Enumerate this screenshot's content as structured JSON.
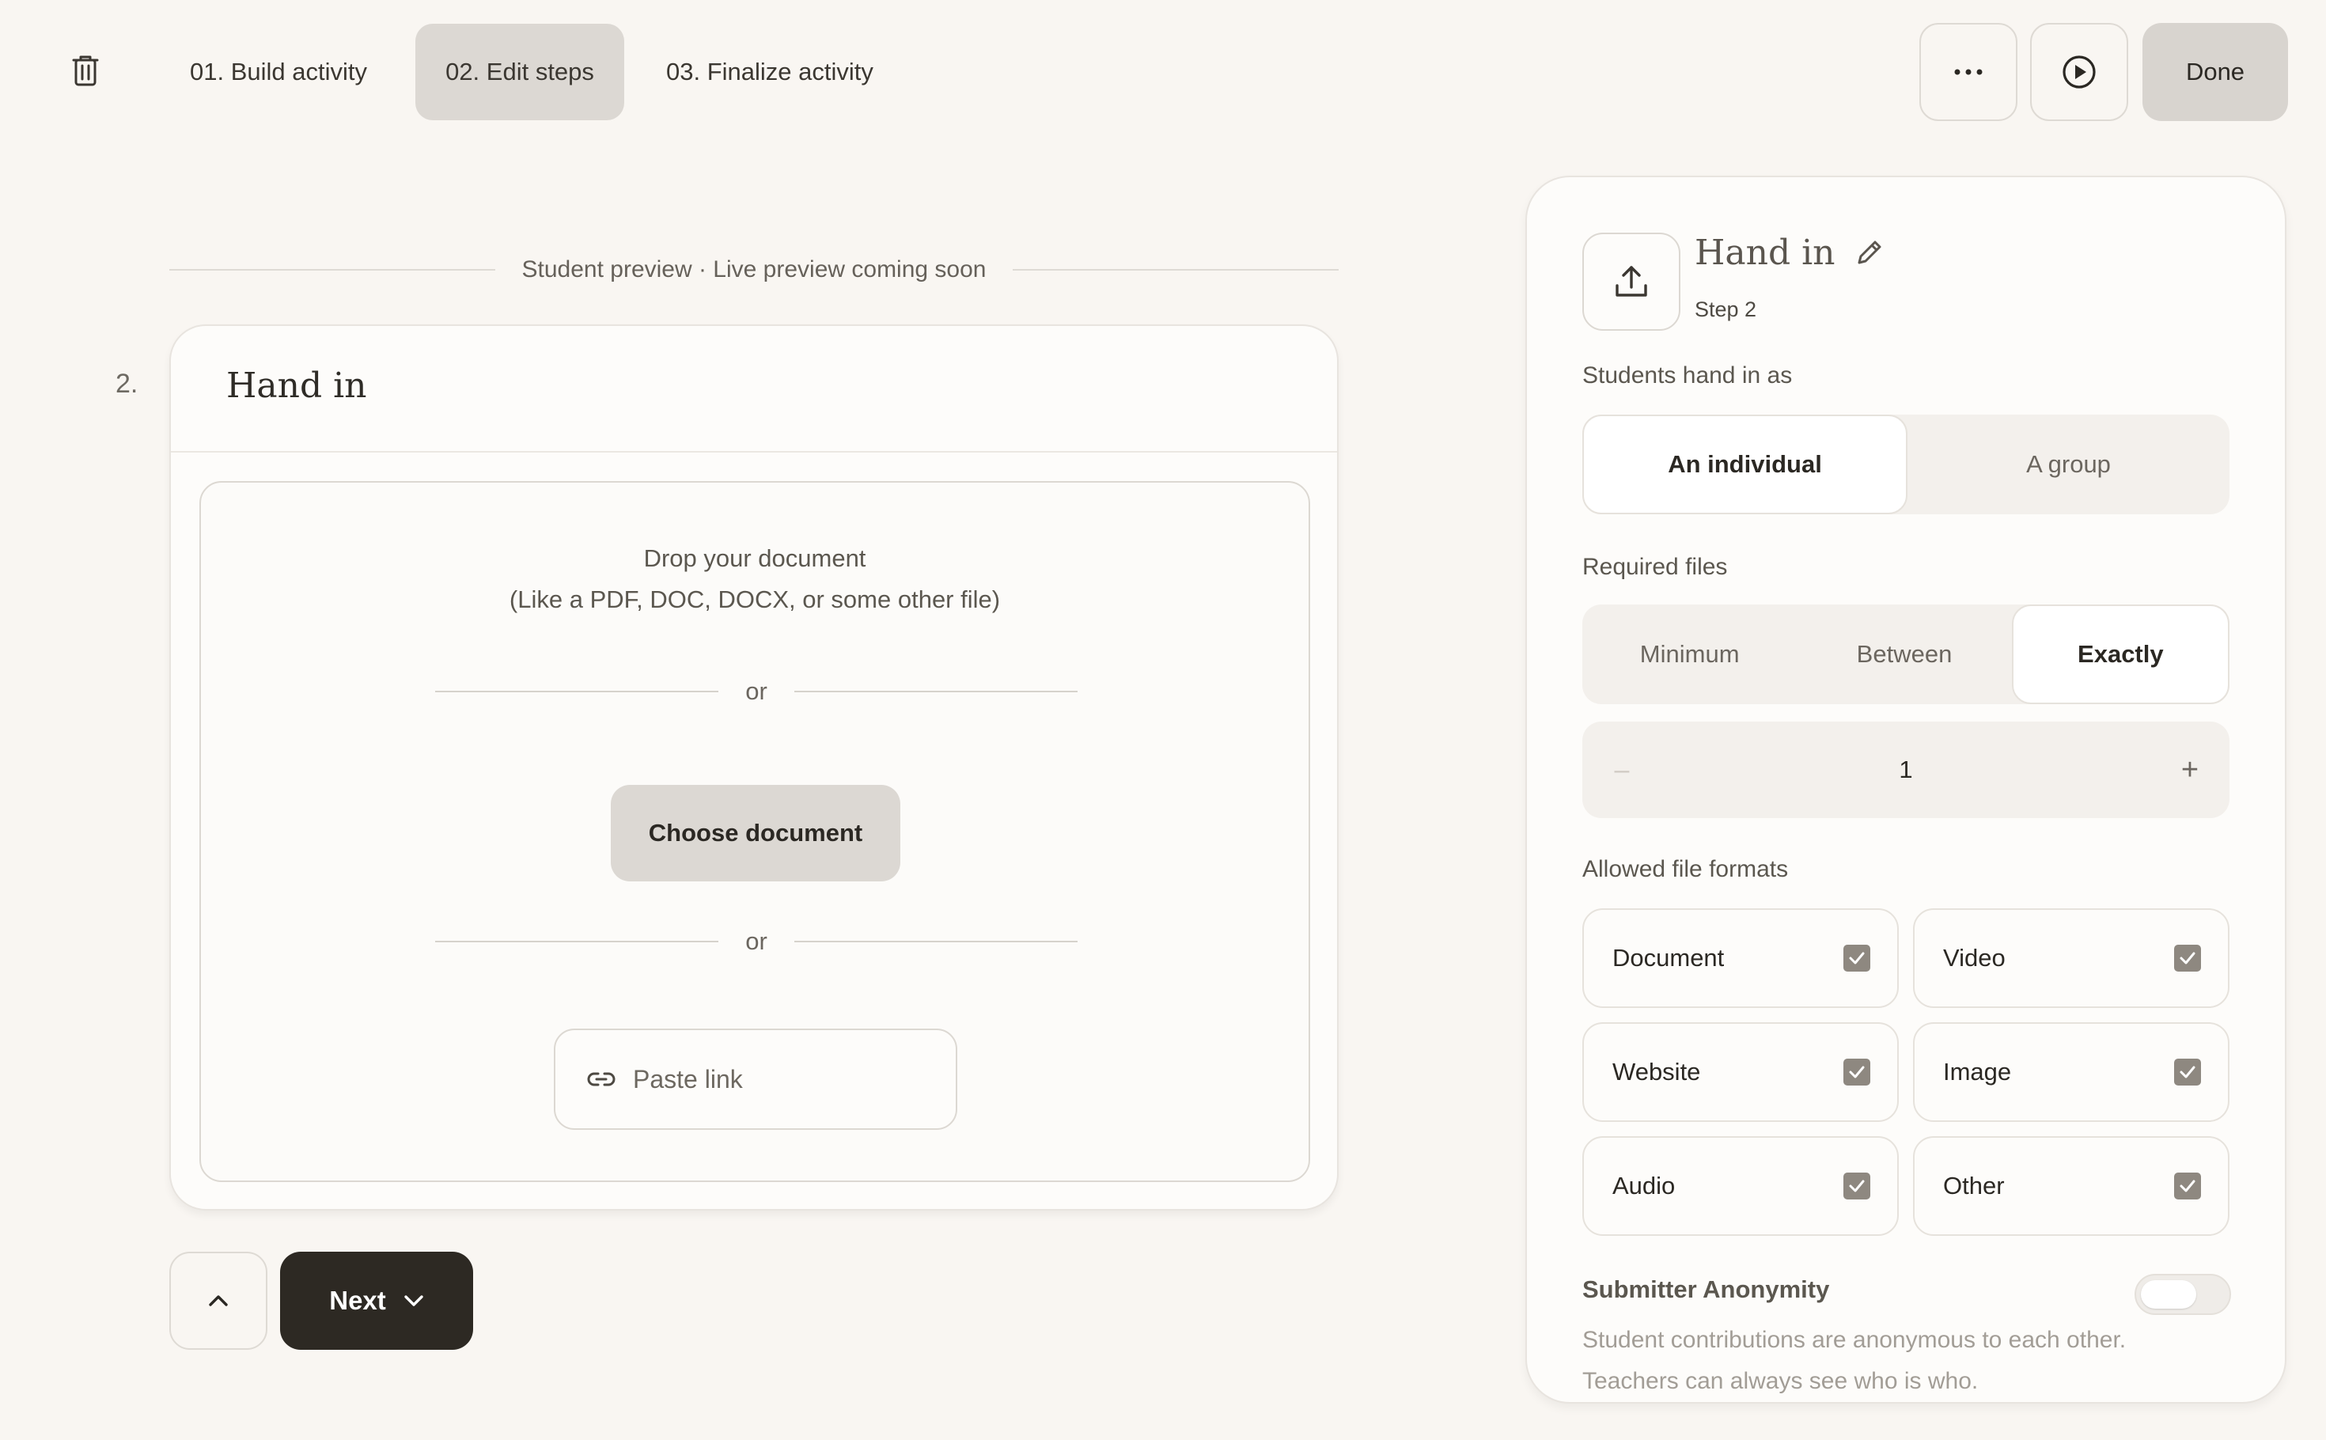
{
  "topbar": {
    "tabs": [
      {
        "label": "01. Build activity",
        "active": false
      },
      {
        "label": "02. Edit steps",
        "active": true
      },
      {
        "label": "03. Finalize activity",
        "active": false
      }
    ],
    "more_icon": "more-horizontal-icon",
    "play_icon": "play-icon",
    "done_label": "Done"
  },
  "preview": {
    "header": "Student preview · Live preview coming soon",
    "step_number": "2.",
    "card_title": "Hand in",
    "drop_line1": "Drop your document",
    "drop_line2": "(Like a PDF, DOC, DOCX, or some other file)",
    "or_text": "or",
    "choose_label": "Choose document",
    "paste_placeholder": "Paste link"
  },
  "nav": {
    "next_label": "Next"
  },
  "panel": {
    "title": "Hand in",
    "step": "Step 2",
    "hand_in_label": "Students hand in as",
    "hand_in_options": [
      "An individual",
      "A group"
    ],
    "hand_in_selected": "An individual",
    "required_label": "Required files",
    "required_options": [
      "Minimum",
      "Between",
      "Exactly"
    ],
    "required_selected": "Exactly",
    "stepper": {
      "minus": "–",
      "value": "1",
      "plus": "+"
    },
    "formats_label": "Allowed file formats",
    "formats": [
      {
        "label": "Document",
        "checked": true
      },
      {
        "label": "Video",
        "checked": true
      },
      {
        "label": "Website",
        "checked": true
      },
      {
        "label": "Image",
        "checked": true
      },
      {
        "label": "Audio",
        "checked": true
      },
      {
        "label": "Other",
        "checked": true
      }
    ],
    "anonymity_label": "Submitter Anonymity",
    "anonymity_on": false,
    "anonymity_desc": "Student contributions are anonymous to each other. Teachers can always see who is who."
  }
}
